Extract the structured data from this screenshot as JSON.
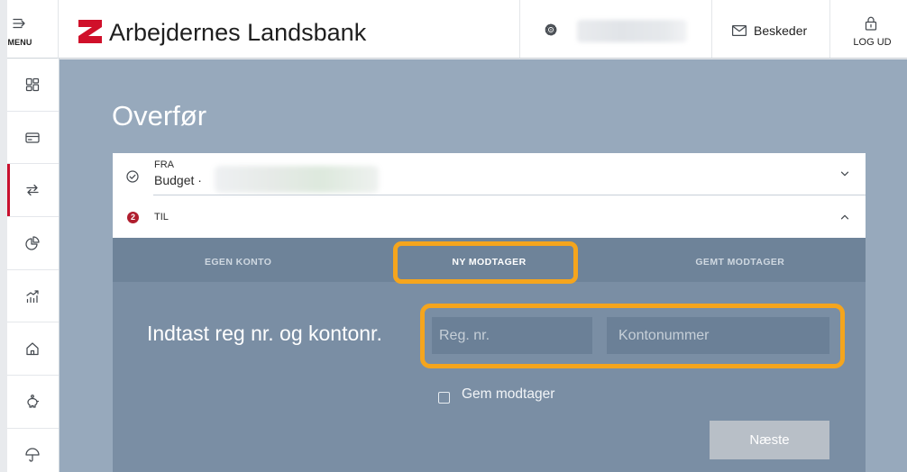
{
  "header": {
    "menu_label": "MENU",
    "menu_icon": "menu-expand-icon",
    "brand_name": "Arbejdernes Landsbank",
    "settings_icon": "gear-icon",
    "messages_label": "Beskeder",
    "messages_icon": "envelope-icon",
    "logout_label": "LOG UD",
    "logout_icon": "lock-icon"
  },
  "sidebar": {
    "items": [
      {
        "icon": "dashboard-icon",
        "active": false
      },
      {
        "icon": "credit-card-icon",
        "active": false
      },
      {
        "icon": "transfer-icon",
        "active": true
      },
      {
        "icon": "pie-chart-icon",
        "active": false
      },
      {
        "icon": "growth-chart-icon",
        "active": false
      },
      {
        "icon": "house-icon",
        "active": false
      },
      {
        "icon": "piggy-bank-icon",
        "active": false
      },
      {
        "icon": "umbrella-icon",
        "active": false
      }
    ]
  },
  "page": {
    "title": "Overfør"
  },
  "transfer": {
    "from": {
      "label": "FRA",
      "account": "Budget ·",
      "status_icon": "check-circle-icon",
      "toggle_icon": "chevron-down-icon"
    },
    "to": {
      "step": "2",
      "label": "TIL",
      "toggle_icon": "chevron-up-icon"
    },
    "tabs": [
      {
        "label": "EGEN KONTO",
        "active": false
      },
      {
        "label": "NY MODTAGER",
        "active": true
      },
      {
        "label": "GEMT MODTAGER",
        "active": false
      }
    ],
    "prompt": "Indtast reg nr. og kontonr.",
    "reg_placeholder": "Reg. nr.",
    "account_placeholder": "Kontonummer",
    "save_recipient_label": "Gem modtager",
    "save_recipient_checked": false,
    "next_label": "Næste",
    "next_enabled": false
  },
  "colors": {
    "brand_red": "#c8102e",
    "highlight": "#f5a51d",
    "page_background": "#97a9bc",
    "tab_bar": "#6e8399",
    "form_panel": "#7a8ea4"
  }
}
